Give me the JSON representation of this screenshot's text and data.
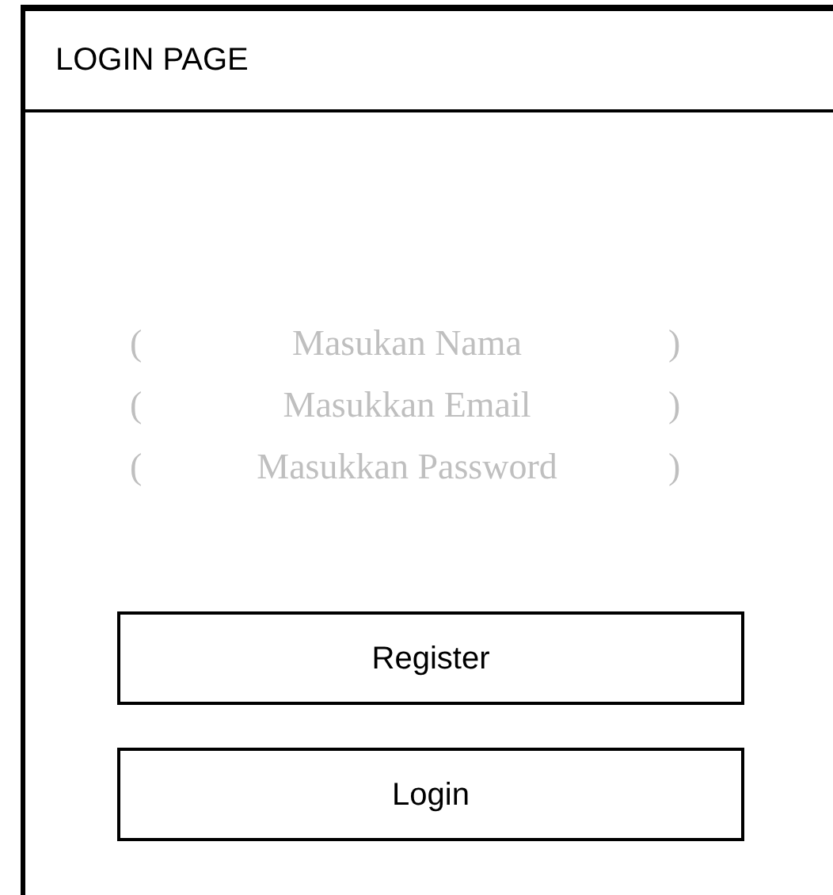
{
  "header": {
    "title": "LOGIN PAGE"
  },
  "fields": [
    {
      "open": "(",
      "placeholder": "Masukan Nama",
      "close": ")"
    },
    {
      "open": "(",
      "placeholder": "Masukkan Email",
      "close": ")"
    },
    {
      "open": "(",
      "placeholder": "Masukkan Password",
      "close": ")"
    }
  ],
  "buttons": [
    "Register",
    "Login"
  ]
}
